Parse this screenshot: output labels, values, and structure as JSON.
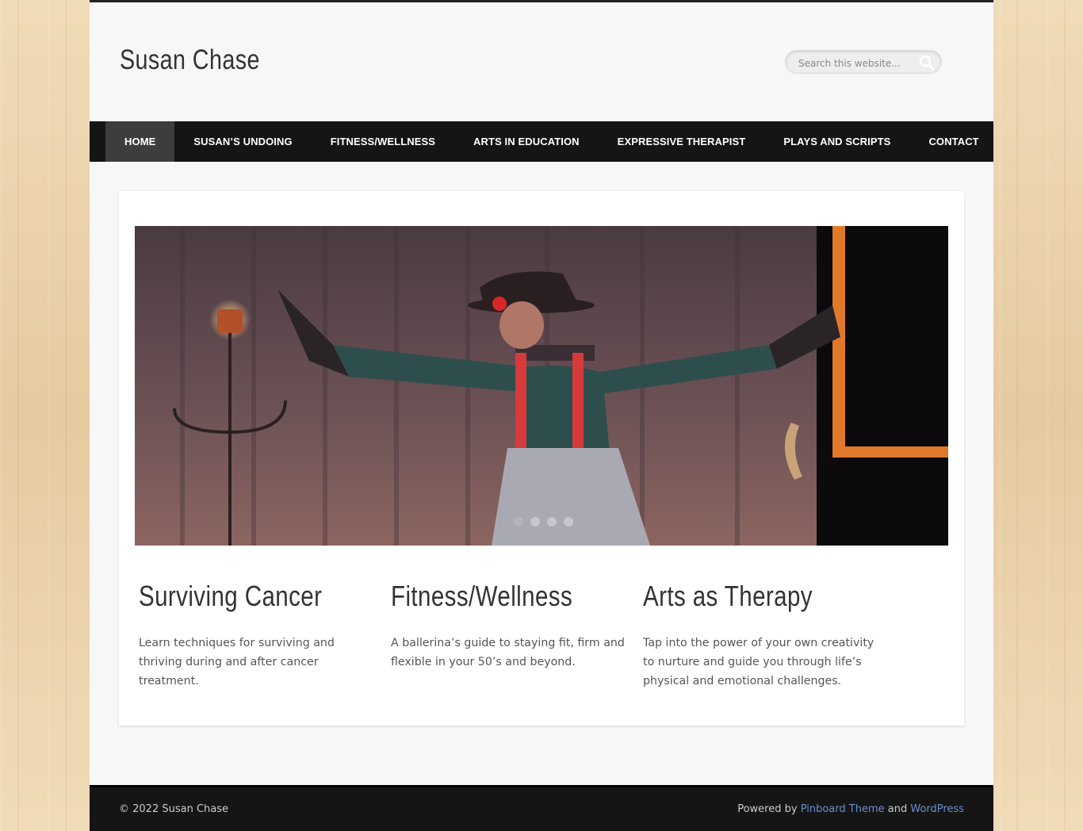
{
  "site": {
    "title": "Susan Chase"
  },
  "search": {
    "placeholder": "Search this website..."
  },
  "nav": {
    "items": [
      {
        "label": "HOME"
      },
      {
        "label": "SUSAN’S UNDOING"
      },
      {
        "label": "FITNESS/WELLNESS"
      },
      {
        "label": "ARTS IN EDUCATION"
      },
      {
        "label": "EXPRESSIVE THERAPIST"
      },
      {
        "label": "PLAYS AND SCRIPTS"
      },
      {
        "label": "CONTACT"
      }
    ],
    "active_index": 0
  },
  "slider": {
    "slide_count": 4,
    "active_slide": 1
  },
  "features": [
    {
      "title": "Surviving Cancer",
      "text": "Learn techniques for surviving and thriving during and after cancer treatment."
    },
    {
      "title": "Fitness/Wellness",
      "text": "A ballerina’s guide to staying fit, firm and flexible in your 50’s and beyond."
    },
    {
      "title": "Arts as Therapy",
      "text": "Tap into the power of your own creativity to nurture and guide you through life’s physical and emotional challenges."
    }
  ],
  "footer": {
    "copyright": "© 2022 Susan Chase",
    "powered_by": "Powered by",
    "theme_link": "Pinboard Theme",
    "and": "and",
    "wp_link": "WordPress"
  },
  "colors": {
    "nav_bg": "#151515",
    "nav_active": "#3d3d3d",
    "link": "#6b8fd0"
  }
}
